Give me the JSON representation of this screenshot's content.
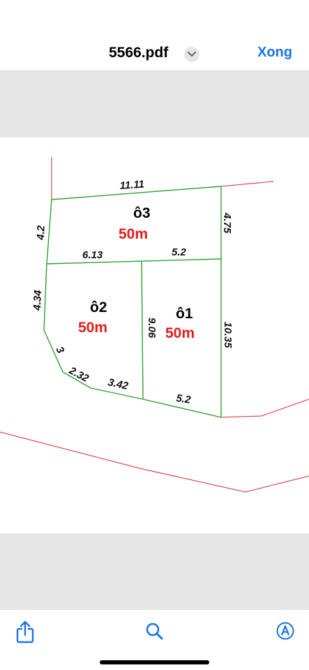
{
  "header": {
    "title": "5566.pdf",
    "done_label": "Xong"
  },
  "plan": {
    "lots": [
      {
        "name": "ô3",
        "area": "50m"
      },
      {
        "name": "ô2",
        "area": "50m"
      },
      {
        "name": "ô1",
        "area": "50m"
      }
    ],
    "dimensions": {
      "top": "11.11",
      "lot3_left": "4.2",
      "lot3_right": "4.75",
      "lot3_bottom_left": "6.13",
      "lot3_bottom_right": "5.2",
      "lot2_left": "4.34",
      "lot2_diag": "3",
      "lot2_lower_a": "2.32",
      "lot2_lower_b": "3.42",
      "mid_vertical": "9.06",
      "lot1_right": "10.35",
      "lot1_bottom": "5.2"
    },
    "colors": {
      "lot_lines": "#2ca02c",
      "boundary_lines": "#d62728",
      "area_text": "#e11d1d"
    }
  },
  "toolbar": {
    "icons": [
      "share-icon",
      "search-icon",
      "markup-icon"
    ]
  },
  "colors": {
    "accent": "#1a73e8"
  }
}
